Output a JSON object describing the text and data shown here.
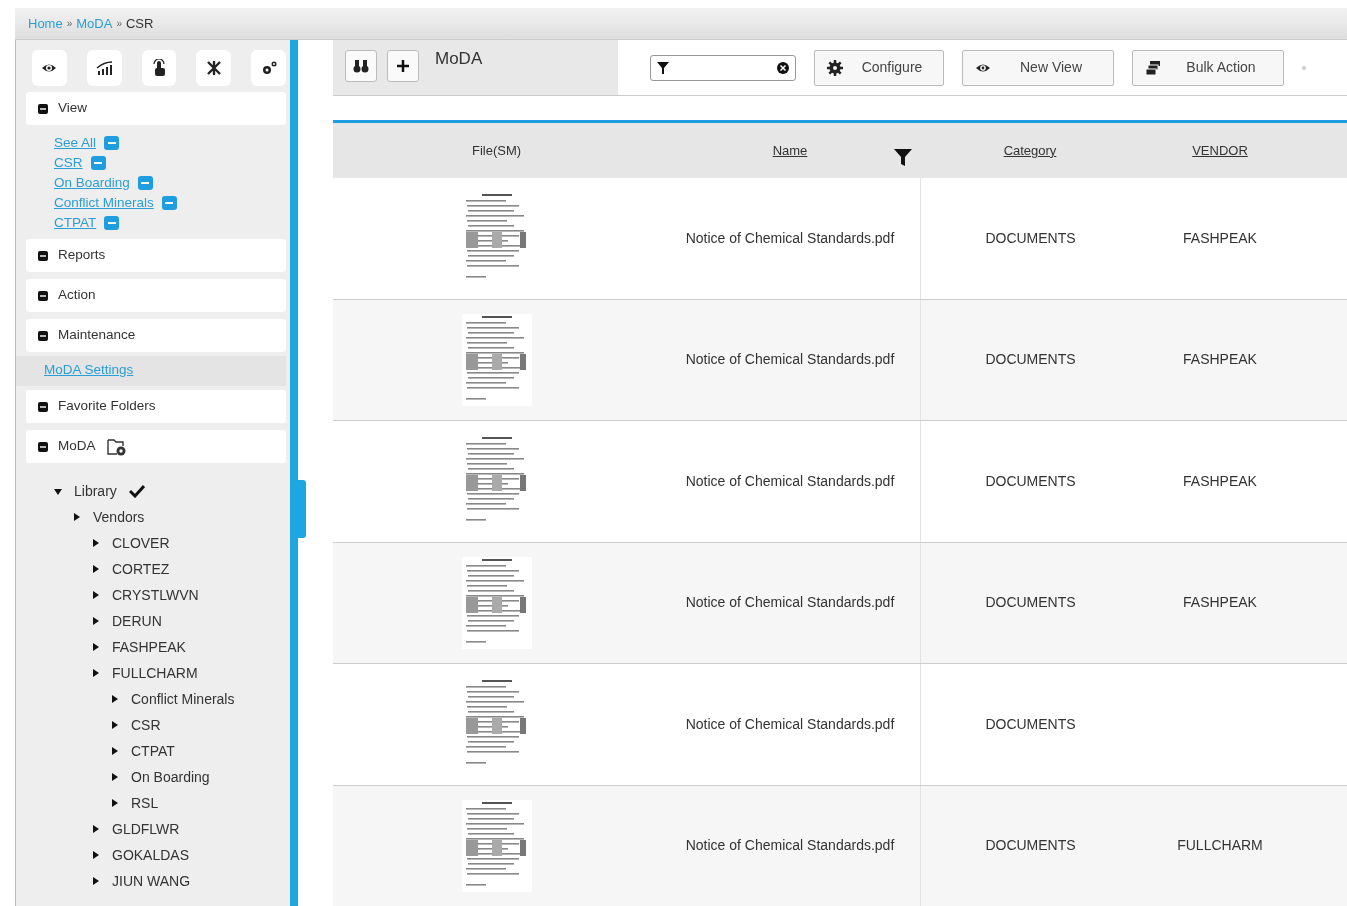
{
  "breadcrumb": {
    "separator": "»",
    "items": [
      {
        "label": "Home",
        "link": true
      },
      {
        "label": "MoDA",
        "link": true
      },
      {
        "label": "CSR",
        "link": false
      }
    ]
  },
  "sidebar": {
    "sections": [
      {
        "label": "View",
        "links": [
          "See All",
          "CSR",
          "On Boarding",
          "Conflict Minerals",
          "CTPAT"
        ],
        "link_badges": true
      },
      {
        "label": "Reports"
      },
      {
        "label": "Action"
      },
      {
        "label": "Maintenance",
        "links": [
          "MoDA Settings"
        ],
        "link_badges": false
      },
      {
        "label": "Favorite Folders"
      },
      {
        "label": "MoDA",
        "folder_icon": true
      }
    ],
    "tree": [
      {
        "label": "Library",
        "expanded": true,
        "checked": true,
        "children": [
          {
            "label": "Vendors",
            "expanded": false,
            "checked": false,
            "children": [
              {
                "label": "CLOVER",
                "expanded": false,
                "checked": false
              },
              {
                "label": "CORTEZ",
                "expanded": false,
                "checked": false
              },
              {
                "label": "CRYSTLWVN",
                "expanded": false,
                "checked": false
              },
              {
                "label": "DERUN",
                "expanded": false,
                "checked": false
              },
              {
                "label": "FASHPEAK",
                "expanded": false,
                "checked": false
              },
              {
                "label": "FULLCHARM",
                "expanded": false,
                "checked": false,
                "children": [
                  {
                    "label": "Conflict Minerals",
                    "expanded": false,
                    "checked": false
                  },
                  {
                    "label": "CSR",
                    "expanded": false,
                    "checked": false
                  },
                  {
                    "label": "CTPAT",
                    "expanded": false,
                    "checked": false
                  },
                  {
                    "label": "On Boarding",
                    "expanded": false,
                    "checked": false
                  },
                  {
                    "label": "RSL",
                    "expanded": false,
                    "checked": false
                  }
                ]
              },
              {
                "label": "GLDFLWR",
                "expanded": false,
                "checked": false
              },
              {
                "label": "GOKALDAS",
                "expanded": false,
                "checked": false
              },
              {
                "label": "JIUN WANG",
                "expanded": false,
                "checked": false
              }
            ]
          }
        ]
      }
    ]
  },
  "toolbar": {
    "title": "MoDA",
    "buttons": [
      "Configure",
      "New View",
      "Bulk Action"
    ]
  },
  "table": {
    "columns": [
      {
        "label": "File(SM)",
        "sortable": false,
        "filter": false
      },
      {
        "label": "Name",
        "sortable": true,
        "filter": true
      },
      {
        "label": "Category",
        "sortable": true,
        "filter": false
      },
      {
        "label": "VENDOR",
        "sortable": true,
        "filter": false
      }
    ],
    "rows": [
      {
        "name": "Notice of Chemical Standards.pdf",
        "category": "DOCUMENTS",
        "vendor": "FASHPEAK"
      },
      {
        "name": "Notice of Chemical Standards.pdf",
        "category": "DOCUMENTS",
        "vendor": "FASHPEAK"
      },
      {
        "name": "Notice of Chemical Standards.pdf",
        "category": "DOCUMENTS",
        "vendor": "FASHPEAK"
      },
      {
        "name": "Notice of Chemical Standards.pdf",
        "category": "DOCUMENTS",
        "vendor": "FASHPEAK"
      },
      {
        "name": "Notice of Chemical Standards.pdf",
        "category": "DOCUMENTS"
      },
      {
        "name": "Notice of Chemical Standards.pdf",
        "category": "DOCUMENTS",
        "vendor": "FULLCHARM"
      }
    ]
  }
}
